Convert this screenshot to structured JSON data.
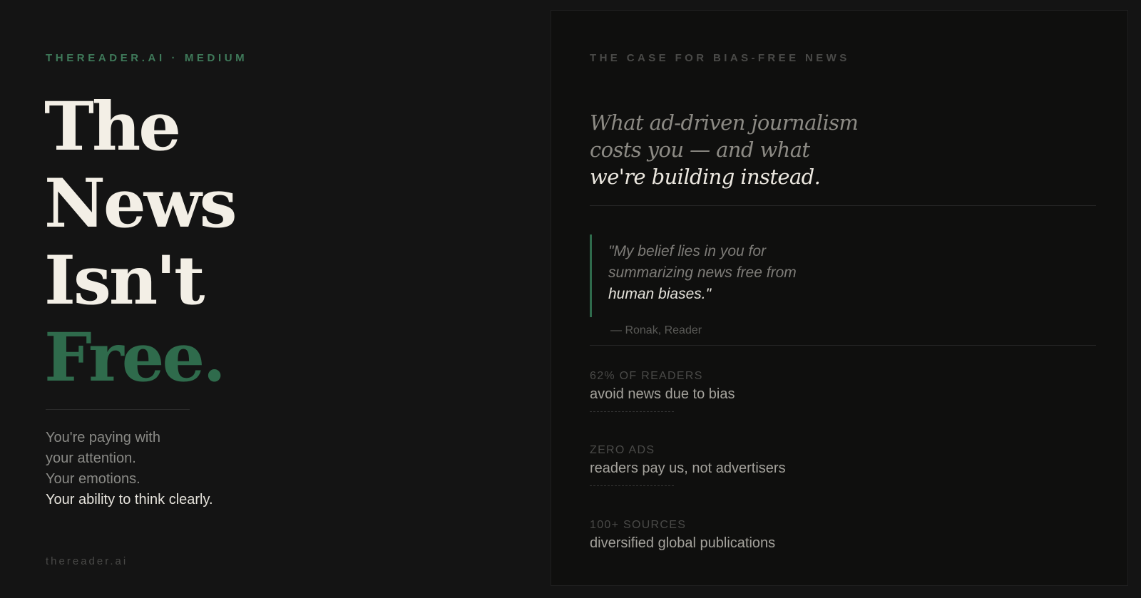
{
  "left": {
    "eyebrow": "THEREADER.AI · MEDIUM",
    "headline": [
      "The",
      "News",
      "Isn't",
      "Free."
    ],
    "lead": [
      "You're paying with",
      "your attention.",
      "Your emotions.",
      "Your ability to think clearly."
    ],
    "footer": "thereader.ai"
  },
  "right": {
    "eyebrow": "THE CASE FOR BIAS-FREE NEWS",
    "subhead": [
      "What ad-driven journalism",
      "costs you — and what",
      "we're building instead."
    ],
    "quote": {
      "lines": [
        "\"My belief lies in you for",
        "summarizing news free from",
        "human biases.\""
      ],
      "attribution": "— Ronak, Reader"
    },
    "stats": [
      {
        "label": "62% OF READERS",
        "desc": "avoid news due to bias"
      },
      {
        "label": "ZERO ADS",
        "desc": "readers pay us, not advertisers"
      },
      {
        "label": "100+ SOURCES",
        "desc": "diversified global publications"
      }
    ]
  },
  "colors": {
    "accent": "#2f6b4c",
    "eyebrow_accent": "#3f7a5a",
    "background": "#141414",
    "panel": "#0f0f0e",
    "headline": "#f3efe6"
  }
}
